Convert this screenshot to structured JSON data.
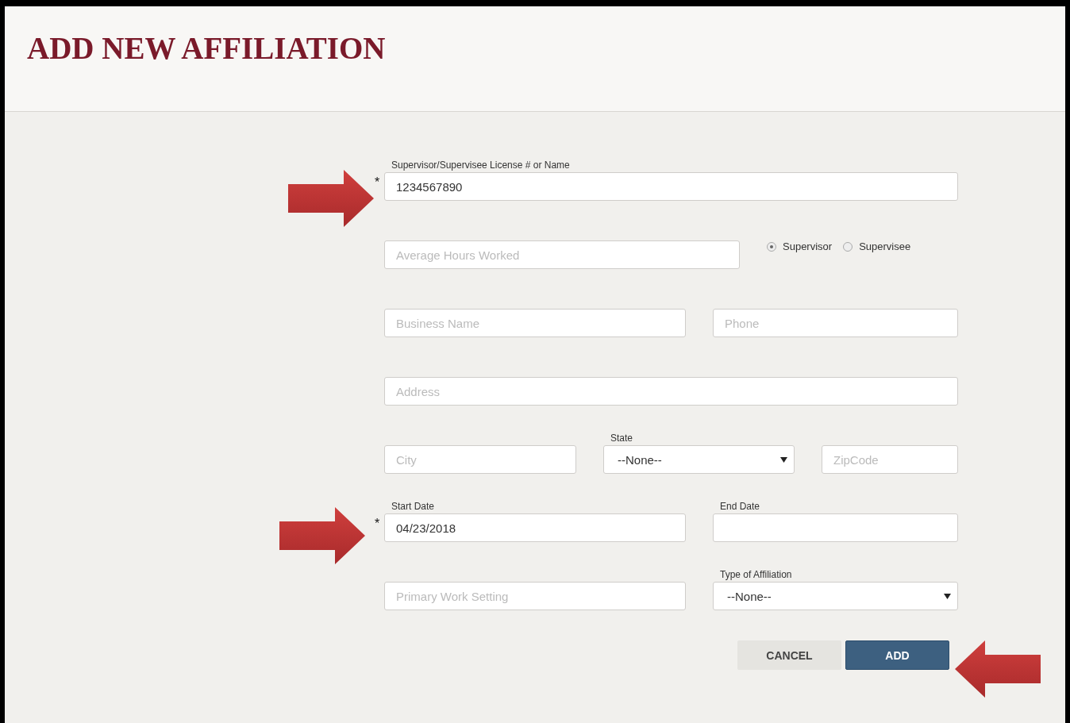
{
  "header": {
    "title": "ADD NEW AFFILIATION"
  },
  "form": {
    "rows": [
      {
        "fields": [
          {
            "kind": "text",
            "label": "Supervisor/Supervisee License # or Name",
            "value": "1234567890",
            "required_mark": "*"
          }
        ]
      },
      {
        "fields": [
          {
            "kind": "text",
            "placeholder": "Average Hours Worked"
          },
          {
            "kind": "radios",
            "options": [
              {
                "label": "Supervisor",
                "selected": true
              },
              {
                "label": "Supervisee",
                "selected": false
              }
            ]
          }
        ]
      },
      {
        "fields": [
          {
            "kind": "text",
            "placeholder": "Business Name"
          },
          {
            "kind": "text",
            "placeholder": "Phone"
          }
        ]
      },
      {
        "fields": [
          {
            "kind": "text",
            "placeholder": "Address"
          }
        ]
      },
      {
        "fields": [
          {
            "kind": "text",
            "placeholder": "City"
          },
          {
            "kind": "select",
            "label": "State",
            "value": "--None--"
          },
          {
            "kind": "text",
            "placeholder": "ZipCode"
          }
        ]
      },
      {
        "fields": [
          {
            "kind": "text",
            "label": "Start Date",
            "value": "04/23/2018",
            "required_mark": "*"
          },
          {
            "kind": "text",
            "label": "End Date"
          }
        ]
      },
      {
        "fields": [
          {
            "kind": "text",
            "placeholder": "Primary Work Setting"
          },
          {
            "kind": "select",
            "label": "Type of Affiliation",
            "value": "--None--"
          }
        ]
      }
    ]
  },
  "buttons": [
    {
      "label": "CANCEL",
      "kind": "secondary"
    },
    {
      "label": "ADD",
      "kind": "primary"
    }
  ]
}
